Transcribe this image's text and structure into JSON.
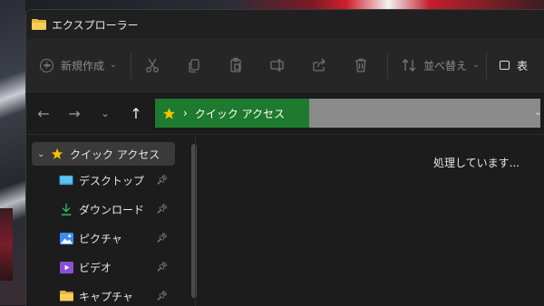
{
  "window": {
    "title": "エクスプローラー"
  },
  "toolbar": {
    "new_label": "新規作成",
    "sort_label": "並べ替え",
    "view_label": "表"
  },
  "address": {
    "location": "クイック アクセス"
  },
  "sidebar": {
    "header": "クイック アクセス",
    "items": [
      {
        "label": "デスクトップ",
        "icon": "desktop-icon"
      },
      {
        "label": "ダウンロード",
        "icon": "download-icon"
      },
      {
        "label": "ピクチャ",
        "icon": "pictures-icon"
      },
      {
        "label": "ビデオ",
        "icon": "videos-icon"
      },
      {
        "label": "キャプチャ",
        "icon": "folder-icon"
      }
    ]
  },
  "content": {
    "status": "処理しています..."
  },
  "colors": {
    "address_progress": "#1d7a2e",
    "window_bg": "#1c1c1c",
    "accent_star": "#f5c400"
  }
}
